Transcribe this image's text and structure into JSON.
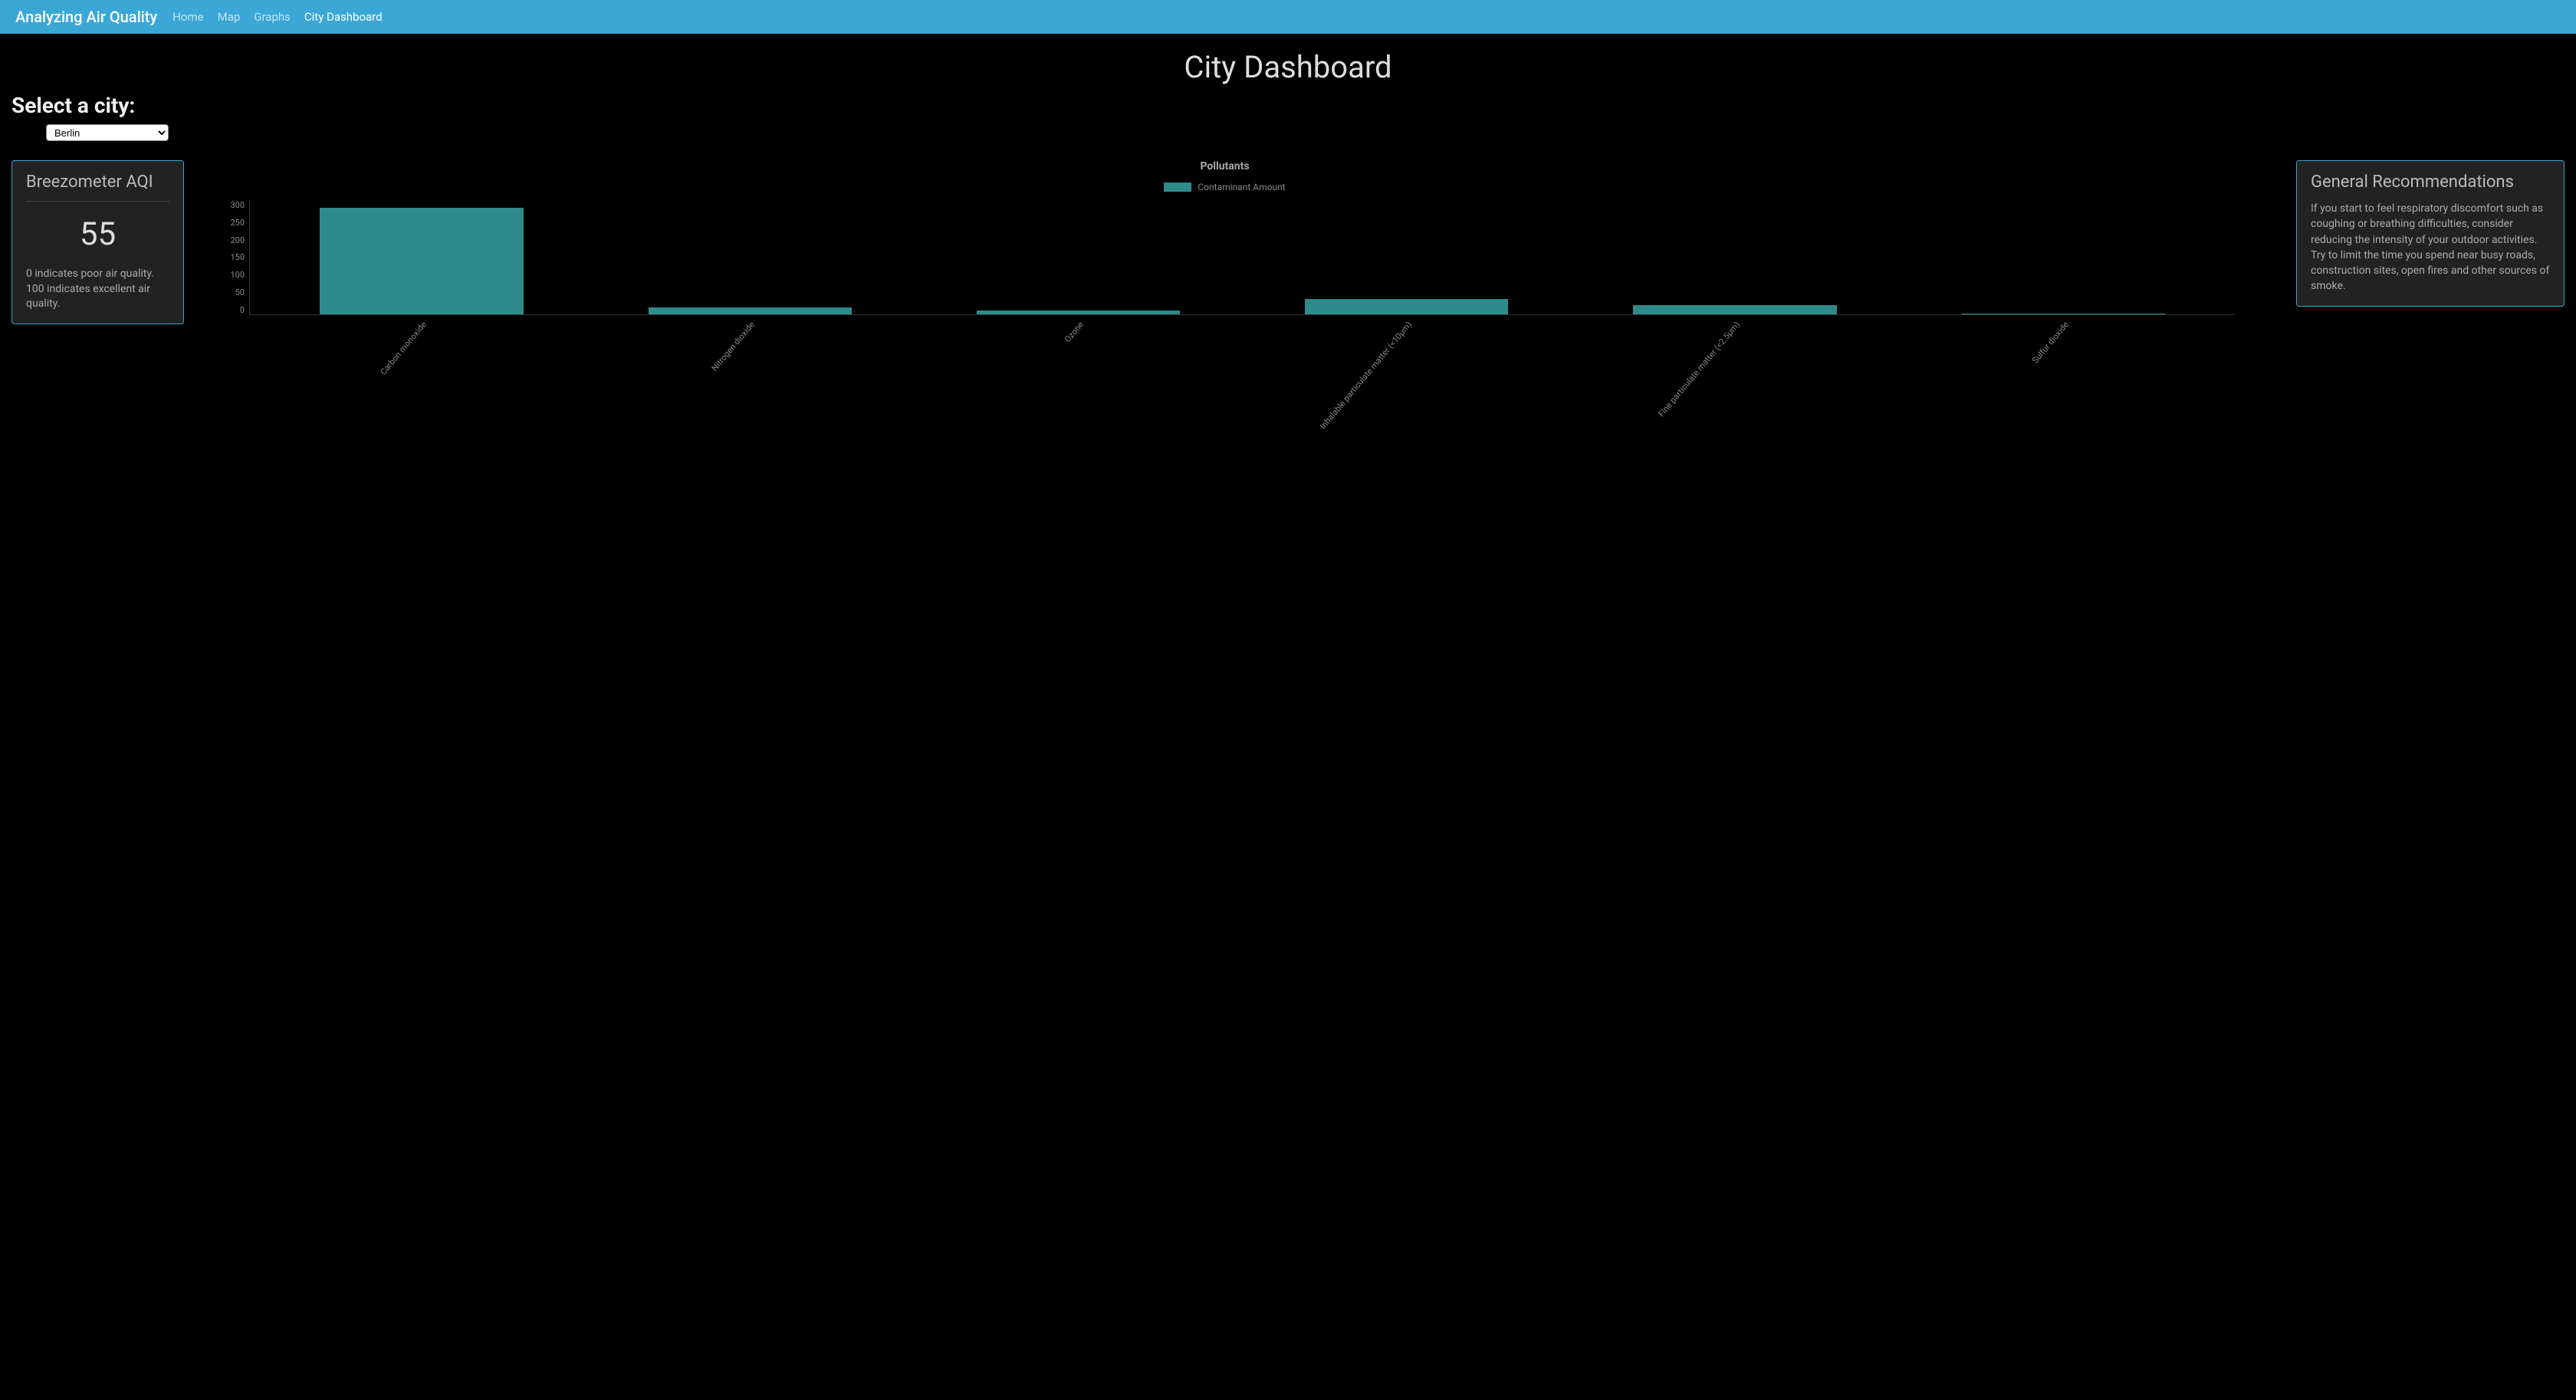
{
  "navbar": {
    "brand": "Analyzing Air Quality",
    "links": [
      {
        "label": "Home",
        "active": false
      },
      {
        "label": "Map",
        "active": false
      },
      {
        "label": "Graphs",
        "active": false
      },
      {
        "label": "City Dashboard",
        "active": true
      }
    ]
  },
  "page": {
    "title": "City Dashboard",
    "select_label": "Select a city:",
    "selected_city": "Berlin"
  },
  "aqi": {
    "title": "Breezometer AQI",
    "value": "55",
    "description": "0 indicates poor air quality. 100 indicates excellent air quality."
  },
  "recommendations": {
    "title": "General Recommendations",
    "text": "If you start to feel respiratory discomfort such as coughing or breathing difficulties, consider reducing the intensity of your outdoor activities. Try to limit the time you spend near busy roads, construction sites, open fires and other sources of smoke."
  },
  "chart_data": {
    "type": "bar",
    "title": "Pollutants",
    "legend": "Contaminant Amount",
    "categories": [
      "Carbon monoxide",
      "Nitrogen dioxide",
      "Ozone",
      "Inhalable particulate matter (<10µm)",
      "Fine particulate matter (<2.5µm)",
      "Sulfur dioxide"
    ],
    "values": [
      280,
      18,
      10,
      40,
      25,
      2
    ],
    "xlabel": "",
    "ylabel": "",
    "ylim": [
      0,
      300
    ],
    "yticks": [
      0,
      50,
      100,
      150,
      200,
      250,
      300
    ],
    "bar_color": "#2e8b8b"
  }
}
